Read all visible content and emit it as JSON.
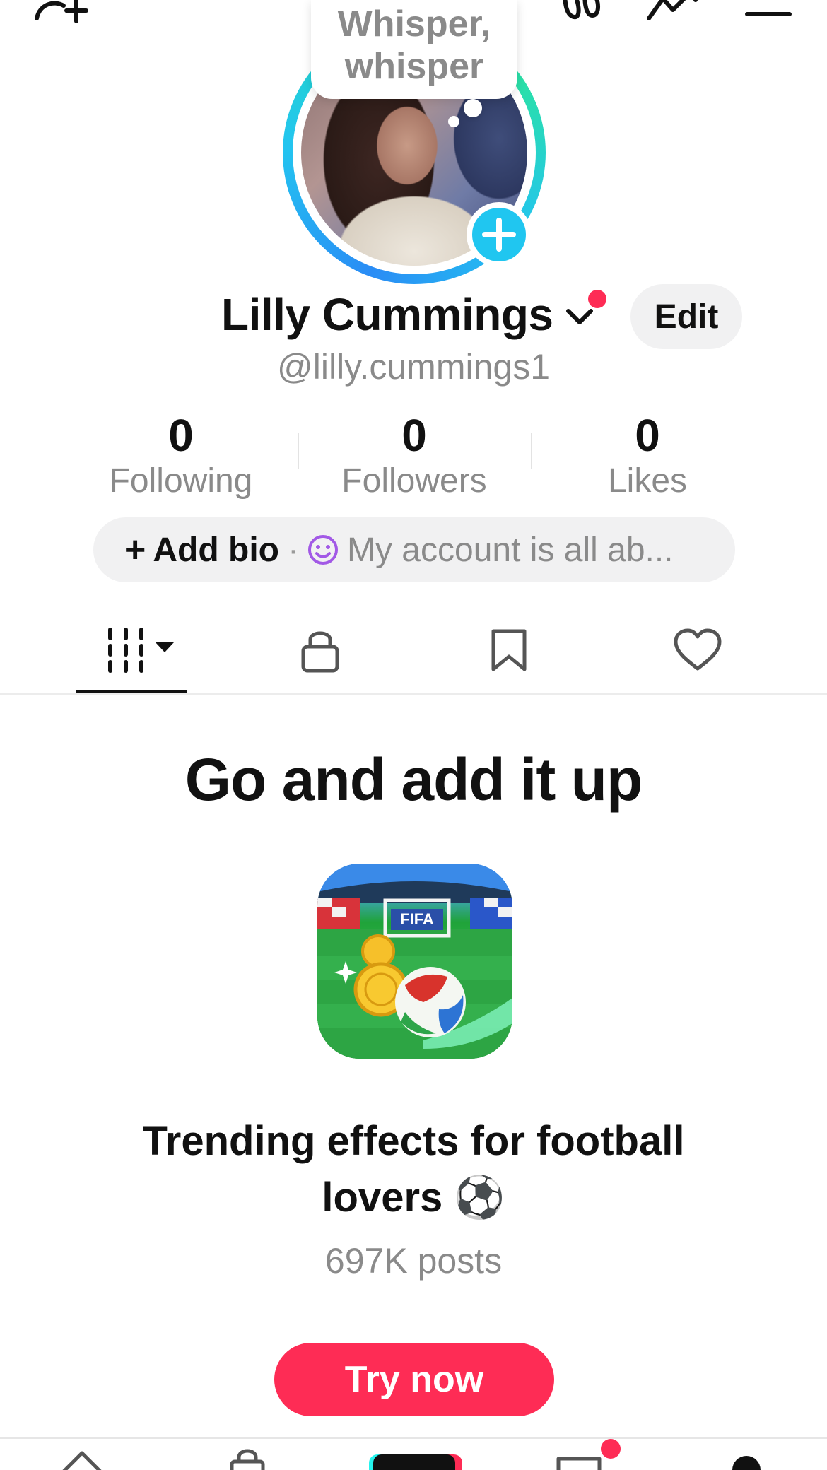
{
  "header": {
    "icons": [
      "add-friend-icon",
      "activity-icon",
      "analytics-icon",
      "menu-icon"
    ]
  },
  "bubble": {
    "line1": "Whisper,",
    "line2": "whisper"
  },
  "profile": {
    "name": "Lilly Cummings",
    "handle": "@lilly.cummings1",
    "edit_label": "Edit"
  },
  "stats": [
    {
      "value": "0",
      "label": "Following"
    },
    {
      "value": "0",
      "label": "Followers"
    },
    {
      "value": "0",
      "label": "Likes"
    }
  ],
  "bio": {
    "plus": "+",
    "add_label": "Add bio",
    "separator": "·",
    "text": "My account is all ab..."
  },
  "tabs": [
    "videos-grid-icon",
    "lock-icon",
    "bookmark-icon",
    "heart-icon"
  ],
  "promo": {
    "title": "Go and  add it up",
    "subtitle_line1": "Trending effects for football",
    "subtitle_line2": "lovers ⚽",
    "posts": "697K posts",
    "button": "Try now",
    "icon_label": "FIFA"
  },
  "bottom_nav": [
    "home-icon",
    "shop-icon",
    "create-icon",
    "inbox-icon",
    "profile-icon"
  ],
  "colors": {
    "accent": "#fe2c55",
    "ring_start": "#2a8cf5",
    "ring_end": "#22dcc0",
    "plus_badge": "#20c6f0"
  }
}
